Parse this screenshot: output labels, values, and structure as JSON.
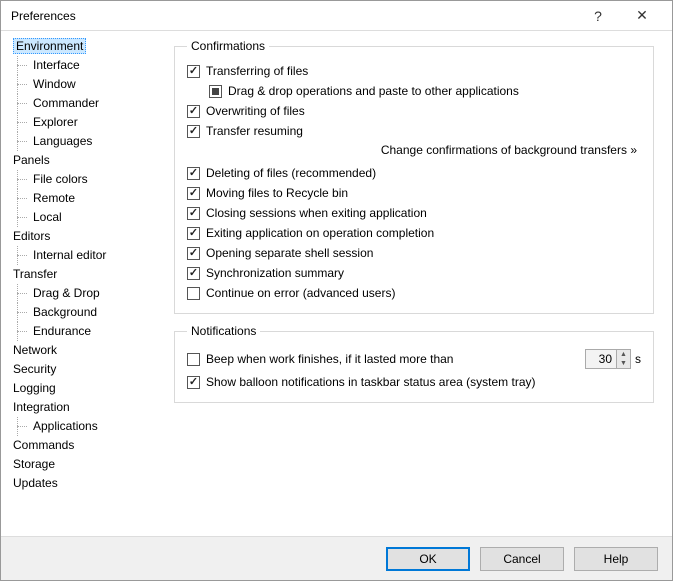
{
  "title": "Preferences",
  "tree": {
    "environment": "Environment",
    "interface": "Interface",
    "window": "Window",
    "commander": "Commander",
    "explorer": "Explorer",
    "languages": "Languages",
    "panels": "Panels",
    "file_colors": "File colors",
    "remote": "Remote",
    "local": "Local",
    "editors": "Editors",
    "internal_editor": "Internal editor",
    "transfer": "Transfer",
    "drag_drop": "Drag & Drop",
    "background": "Background",
    "endurance": "Endurance",
    "network": "Network",
    "security": "Security",
    "logging": "Logging",
    "integration": "Integration",
    "applications": "Applications",
    "commands": "Commands",
    "storage": "Storage",
    "updates": "Updates"
  },
  "groups": {
    "confirmations": "Confirmations",
    "notifications": "Notifications"
  },
  "confirm": {
    "transferring": "Transferring of files",
    "drag_paste": "Drag & drop operations and paste to other applications",
    "overwriting": "Overwriting of files",
    "resuming": "Transfer resuming",
    "change_bg": "Change confirmations of background transfers »",
    "deleting": "Deleting of files (recommended)",
    "recycle": "Moving files to Recycle bin",
    "closing": "Closing sessions when exiting application",
    "exiting": "Exiting application on operation completion",
    "shell": "Opening separate shell session",
    "sync": "Synchronization summary",
    "continue_err": "Continue on error (advanced users)"
  },
  "notif": {
    "beep": "Beep when work finishes, if it lasted more than",
    "beep_seconds": "30",
    "beep_unit": "s",
    "balloon": "Show balloon notifications in taskbar status area (system tray)"
  },
  "buttons": {
    "ok": "OK",
    "cancel": "Cancel",
    "help": "Help"
  }
}
